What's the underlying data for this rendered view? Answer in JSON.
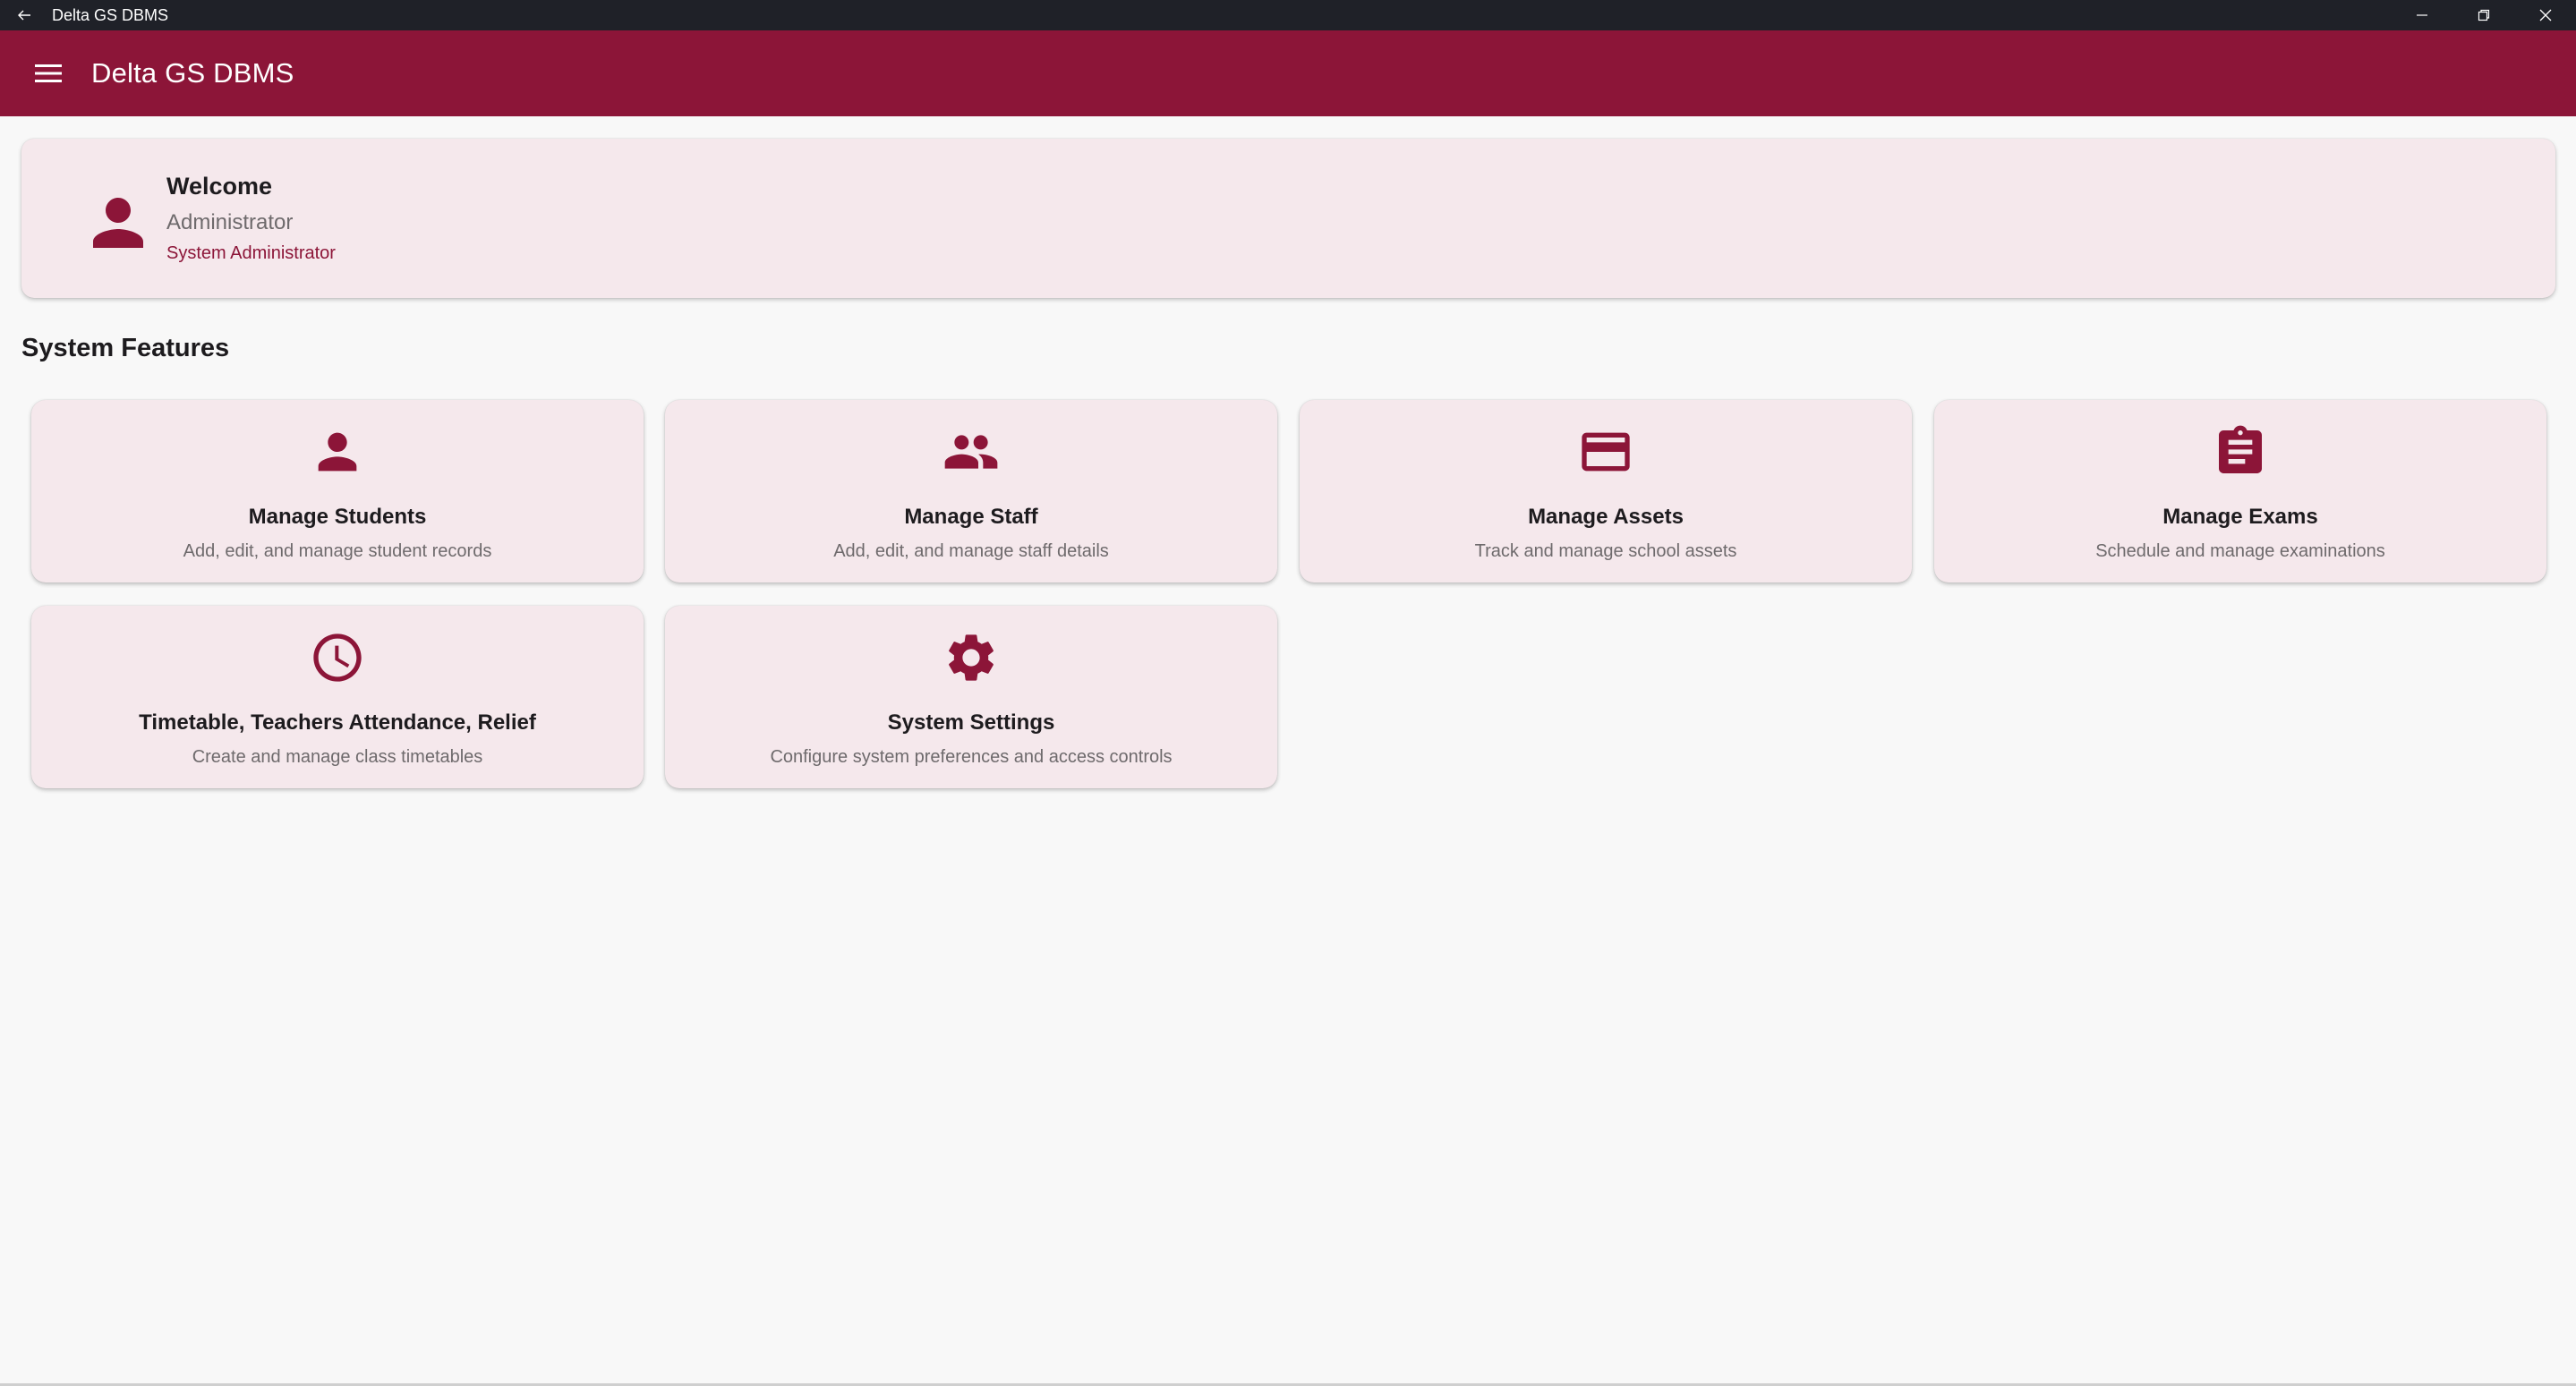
{
  "window": {
    "title": "Delta GS DBMS",
    "icons": [
      "back-arrow-icon",
      "minimize-icon",
      "restore-icon",
      "close-icon"
    ]
  },
  "appbar": {
    "title": "Delta GS DBMS",
    "menu_icon": "hamburger-menu-icon",
    "color": "#8c1538"
  },
  "welcome": {
    "heading": "Welcome",
    "user": "Administrator",
    "role": "System Administrator",
    "icon": "person-icon"
  },
  "section_title": "System Features",
  "features": [
    {
      "title": "Manage Students",
      "description": "Add, edit, and manage student records",
      "icon": "person-icon"
    },
    {
      "title": "Manage Staff",
      "description": "Add, edit, and manage staff details",
      "icon": "people-icon"
    },
    {
      "title": "Manage Assets",
      "description": "Track and manage school assets",
      "icon": "credit-card-icon"
    },
    {
      "title": "Manage Exams",
      "description": "Schedule and manage examinations",
      "icon": "clipboard-icon"
    },
    {
      "title": "Timetable, Teachers Attendance, Relief",
      "description": "Create and manage class timetables",
      "icon": "clock-icon"
    },
    {
      "title": "System Settings",
      "description": "Configure system preferences and access controls",
      "icon": "gear-icon"
    }
  ],
  "colors": {
    "accent": "#8c1538",
    "card_background": "#f5e8ec",
    "page_background": "#f8f8f8",
    "titlebar_background": "#1f2128"
  }
}
